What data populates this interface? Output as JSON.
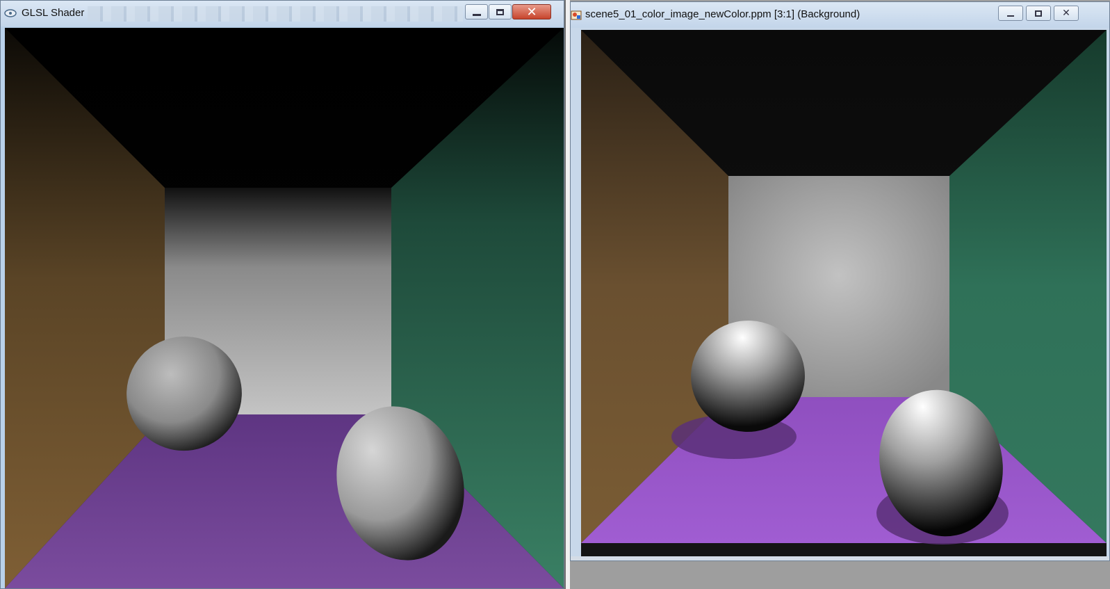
{
  "windows": {
    "glsl": {
      "title": "GLSL Shader",
      "controls": {
        "minimize": "minimize",
        "maximize": "maximize",
        "close": "close"
      },
      "icon": "glsl-app-icon"
    },
    "image": {
      "title": "scene5_01_color_image_newColor.ppm [3:1] (Background)",
      "controls": {
        "minimize": "minimize",
        "restore": "restore",
        "close": "close"
      },
      "icon": "image-viewer-icon"
    }
  },
  "colors": {
    "left_wall": "#7a5c34",
    "right_wall": "#34785e",
    "floor_glsl": "#6b3e8d",
    "floor_ppm": "#9a56c8",
    "back_wall": "#c8c8c8",
    "ceiling": "#000000",
    "close_button": "#c7442c"
  }
}
